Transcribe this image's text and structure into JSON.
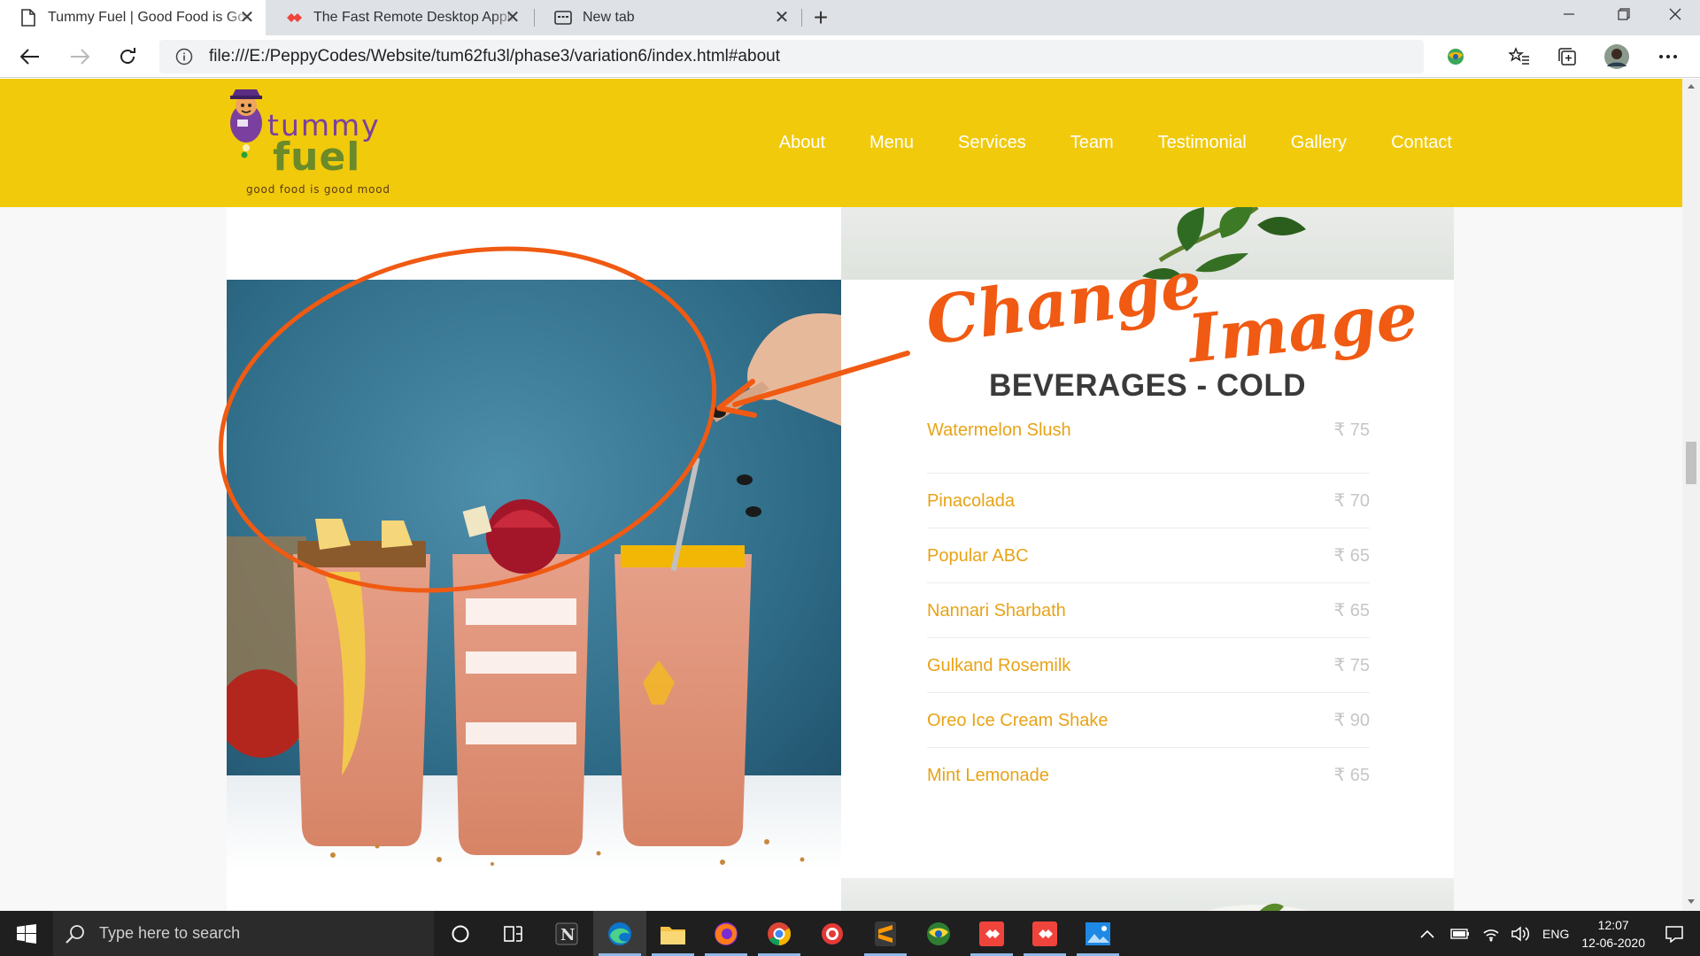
{
  "browser": {
    "tabs": [
      {
        "title": "Tummy Fuel | Good Food is Good Mood",
        "active": true
      },
      {
        "title": "The Fast Remote Desktop Application",
        "active": false
      },
      {
        "title": "New tab",
        "active": false
      }
    ],
    "address_url": "file:///E:/PeppyCodes/Website/tum62fu3l/phase3/variation6/index.html#about",
    "new_tab_symbol": "+",
    "close_symbol": "✕"
  },
  "site": {
    "logo": {
      "word1": "tummy",
      "word2": "fuel",
      "tagline": "good food is good mood"
    },
    "nav": [
      "About",
      "Menu",
      "Services",
      "Team",
      "Testimonial",
      "Gallery",
      "Contact"
    ]
  },
  "menu": {
    "title": "BEVERAGES - COLD",
    "items": [
      {
        "name": "Watermelon Slush",
        "price": "₹ 75"
      },
      {
        "name": "Pinacolada",
        "price": "₹ 70"
      },
      {
        "name": "Popular ABC",
        "price": "₹ 65"
      },
      {
        "name": "Nannari Sharbath",
        "price": "₹ 65"
      },
      {
        "name": "Gulkand Rosemilk",
        "price": "₹ 75"
      },
      {
        "name": "Oreo Ice Cream Shake",
        "price": "₹ 90"
      },
      {
        "name": "Mint Lemonade",
        "price": "₹ 65"
      }
    ]
  },
  "annotation": {
    "word1": "Change",
    "word2": "Image",
    "color": "#f05a12"
  },
  "taskbar": {
    "search_placeholder": "Type here to search",
    "language": "ENG",
    "time": "12:07",
    "date": "12-06-2020"
  },
  "colors": {
    "header_yellow": "#f1ca0c",
    "menu_item_orange": "#e8a317",
    "price_grey": "#c6c6c6"
  }
}
